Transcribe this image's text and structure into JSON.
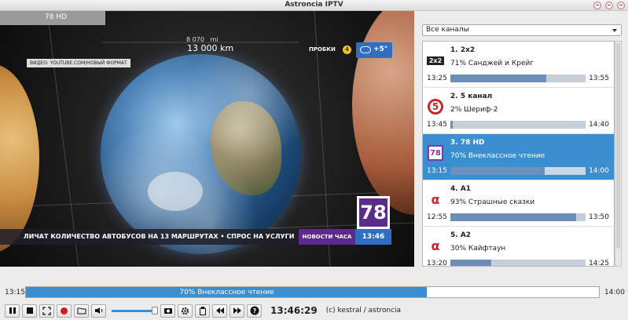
{
  "window": {
    "title": "Astroncia IPTV"
  },
  "video": {
    "channel_tab": "78 HD",
    "distance_mi": "8 070",
    "distance_mi_unit": "mi",
    "distance_km": "13 000 km",
    "traffic_label": "ПРОБКИ",
    "traffic_level": "4",
    "weather_temp": "+5°",
    "source_label": "ВИДЕО: YOUTUBE.COM/НОВЫЙ ФОРМАТ",
    "logo_text": "78",
    "ticker_text": "ЛИЧАТ КОЛИЧЕСТВО АВТОБУСОВ НА 13 МАРШРУТАХ   •   СПРОС НА УСЛУГИ",
    "news_label": "НОВОСТИ ЧАСА",
    "news_time": "13:46"
  },
  "panel": {
    "filter_selected": "Все каналы",
    "channels": [
      {
        "name": "1. 2x2",
        "logo_text": "2x2",
        "logo": "2x2-logo",
        "program": "71% Санджей и Крейг",
        "start": "13:25",
        "end": "13:55",
        "progress": 0.71,
        "selected": false
      },
      {
        "name": "2. 5 канал",
        "logo_text": "5",
        "logo": "5-kanal-logo",
        "program": "2% Шериф-2",
        "start": "13:45",
        "end": "14:40",
        "progress": 0.02,
        "selected": false
      },
      {
        "name": "3. 78 HD",
        "logo_text": "78",
        "logo": "78-logo",
        "program": "70% Внеклассное чтение",
        "start": "13:15",
        "end": "14:00",
        "progress": 0.7,
        "selected": true
      },
      {
        "name": "4. A1",
        "logo_text": "α",
        "logo": "a1-logo",
        "program": "93% Страшные сказки",
        "start": "12:55",
        "end": "13:50",
        "progress": 0.93,
        "selected": false
      },
      {
        "name": "5. A2",
        "logo_text": "α",
        "logo": "a2-logo",
        "program": "30% Кайфтаун",
        "start": "13:20",
        "end": "14:25",
        "progress": 0.3,
        "selected": false
      }
    ]
  },
  "playback": {
    "start": "13:15",
    "end": "14:00",
    "label": "70% Внеклассное чтение",
    "progress": 0.7
  },
  "controls": {
    "volume": 0.95,
    "clock": "13:46:29",
    "credits": "(c) kestral / astroncia",
    "icons": [
      "pause-icon",
      "stop-icon",
      "fullscreen-icon",
      "record-icon",
      "open-folder-icon",
      "volume-icon",
      "screenshot-icon",
      "settings-icon",
      "clipboard-icon",
      "previous-icon",
      "next-icon",
      "help-icon"
    ]
  },
  "colors": {
    "accent": "#3b8fd0",
    "purple": "#5b2a8a",
    "record": "#e0151b"
  }
}
